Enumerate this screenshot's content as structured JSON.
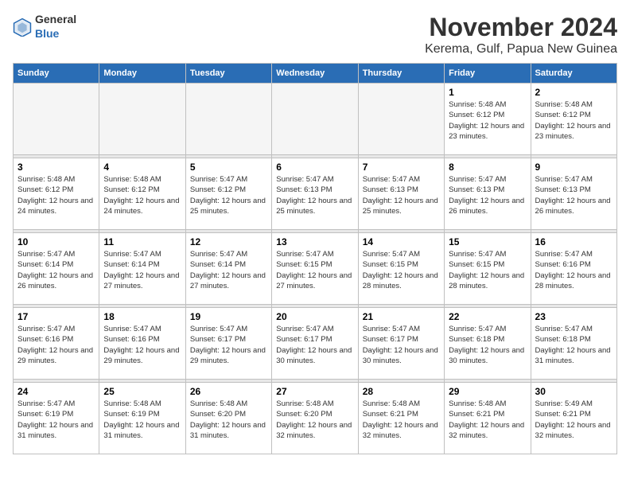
{
  "logo": {
    "text_general": "General",
    "text_blue": "Blue"
  },
  "header": {
    "month": "November 2024",
    "location": "Kerema, Gulf, Papua New Guinea"
  },
  "weekdays": [
    "Sunday",
    "Monday",
    "Tuesday",
    "Wednesday",
    "Thursday",
    "Friday",
    "Saturday"
  ],
  "weeks": [
    [
      {
        "day": "",
        "info": ""
      },
      {
        "day": "",
        "info": ""
      },
      {
        "day": "",
        "info": ""
      },
      {
        "day": "",
        "info": ""
      },
      {
        "day": "",
        "info": ""
      },
      {
        "day": "1",
        "info": "Sunrise: 5:48 AM\nSunset: 6:12 PM\nDaylight: 12 hours and 23 minutes."
      },
      {
        "day": "2",
        "info": "Sunrise: 5:48 AM\nSunset: 6:12 PM\nDaylight: 12 hours and 23 minutes."
      }
    ],
    [
      {
        "day": "3",
        "info": "Sunrise: 5:48 AM\nSunset: 6:12 PM\nDaylight: 12 hours and 24 minutes."
      },
      {
        "day": "4",
        "info": "Sunrise: 5:48 AM\nSunset: 6:12 PM\nDaylight: 12 hours and 24 minutes."
      },
      {
        "day": "5",
        "info": "Sunrise: 5:47 AM\nSunset: 6:12 PM\nDaylight: 12 hours and 25 minutes."
      },
      {
        "day": "6",
        "info": "Sunrise: 5:47 AM\nSunset: 6:13 PM\nDaylight: 12 hours and 25 minutes."
      },
      {
        "day": "7",
        "info": "Sunrise: 5:47 AM\nSunset: 6:13 PM\nDaylight: 12 hours and 25 minutes."
      },
      {
        "day": "8",
        "info": "Sunrise: 5:47 AM\nSunset: 6:13 PM\nDaylight: 12 hours and 26 minutes."
      },
      {
        "day": "9",
        "info": "Sunrise: 5:47 AM\nSunset: 6:13 PM\nDaylight: 12 hours and 26 minutes."
      }
    ],
    [
      {
        "day": "10",
        "info": "Sunrise: 5:47 AM\nSunset: 6:14 PM\nDaylight: 12 hours and 26 minutes."
      },
      {
        "day": "11",
        "info": "Sunrise: 5:47 AM\nSunset: 6:14 PM\nDaylight: 12 hours and 27 minutes."
      },
      {
        "day": "12",
        "info": "Sunrise: 5:47 AM\nSunset: 6:14 PM\nDaylight: 12 hours and 27 minutes."
      },
      {
        "day": "13",
        "info": "Sunrise: 5:47 AM\nSunset: 6:15 PM\nDaylight: 12 hours and 27 minutes."
      },
      {
        "day": "14",
        "info": "Sunrise: 5:47 AM\nSunset: 6:15 PM\nDaylight: 12 hours and 28 minutes."
      },
      {
        "day": "15",
        "info": "Sunrise: 5:47 AM\nSunset: 6:15 PM\nDaylight: 12 hours and 28 minutes."
      },
      {
        "day": "16",
        "info": "Sunrise: 5:47 AM\nSunset: 6:16 PM\nDaylight: 12 hours and 28 minutes."
      }
    ],
    [
      {
        "day": "17",
        "info": "Sunrise: 5:47 AM\nSunset: 6:16 PM\nDaylight: 12 hours and 29 minutes."
      },
      {
        "day": "18",
        "info": "Sunrise: 5:47 AM\nSunset: 6:16 PM\nDaylight: 12 hours and 29 minutes."
      },
      {
        "day": "19",
        "info": "Sunrise: 5:47 AM\nSunset: 6:17 PM\nDaylight: 12 hours and 29 minutes."
      },
      {
        "day": "20",
        "info": "Sunrise: 5:47 AM\nSunset: 6:17 PM\nDaylight: 12 hours and 30 minutes."
      },
      {
        "day": "21",
        "info": "Sunrise: 5:47 AM\nSunset: 6:17 PM\nDaylight: 12 hours and 30 minutes."
      },
      {
        "day": "22",
        "info": "Sunrise: 5:47 AM\nSunset: 6:18 PM\nDaylight: 12 hours and 30 minutes."
      },
      {
        "day": "23",
        "info": "Sunrise: 5:47 AM\nSunset: 6:18 PM\nDaylight: 12 hours and 31 minutes."
      }
    ],
    [
      {
        "day": "24",
        "info": "Sunrise: 5:47 AM\nSunset: 6:19 PM\nDaylight: 12 hours and 31 minutes."
      },
      {
        "day": "25",
        "info": "Sunrise: 5:48 AM\nSunset: 6:19 PM\nDaylight: 12 hours and 31 minutes."
      },
      {
        "day": "26",
        "info": "Sunrise: 5:48 AM\nSunset: 6:20 PM\nDaylight: 12 hours and 31 minutes."
      },
      {
        "day": "27",
        "info": "Sunrise: 5:48 AM\nSunset: 6:20 PM\nDaylight: 12 hours and 32 minutes."
      },
      {
        "day": "28",
        "info": "Sunrise: 5:48 AM\nSunset: 6:21 PM\nDaylight: 12 hours and 32 minutes."
      },
      {
        "day": "29",
        "info": "Sunrise: 5:48 AM\nSunset: 6:21 PM\nDaylight: 12 hours and 32 minutes."
      },
      {
        "day": "30",
        "info": "Sunrise: 5:49 AM\nSunset: 6:21 PM\nDaylight: 12 hours and 32 minutes."
      }
    ]
  ]
}
